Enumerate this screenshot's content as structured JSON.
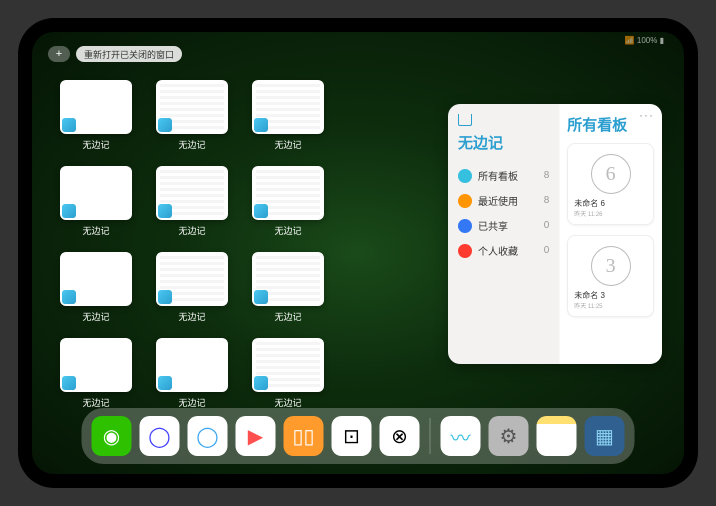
{
  "statusBar": {
    "battery": "100%"
  },
  "topBar": {
    "plusLabel": "+",
    "reopenLabel": "重新打开已关闭的窗口"
  },
  "appGrid": {
    "label": "无边记",
    "windows": [
      {
        "hasContent": false
      },
      {
        "hasContent": true
      },
      {
        "hasContent": true
      },
      null,
      {
        "hasContent": false
      },
      {
        "hasContent": true
      },
      {
        "hasContent": true
      },
      null,
      {
        "hasContent": false
      },
      {
        "hasContent": true
      },
      {
        "hasContent": true
      },
      null,
      {
        "hasContent": false
      },
      {
        "hasContent": false
      },
      {
        "hasContent": true
      },
      null
    ]
  },
  "panel": {
    "leftTitle": "无边记",
    "rightTitle": "所有看板",
    "moreLabel": "···",
    "menu": [
      {
        "label": "所有看板",
        "color": "#34C0DE",
        "count": "8"
      },
      {
        "label": "最近使用",
        "color": "#FF9500",
        "count": "8"
      },
      {
        "label": "已共享",
        "color": "#3478F6",
        "count": "0"
      },
      {
        "label": "个人收藏",
        "color": "#FF3B30",
        "count": "0"
      }
    ],
    "cards": [
      {
        "sketch": "6",
        "title": "未命名 6",
        "subtitle": "昨天 11:26"
      },
      {
        "sketch": "3",
        "title": "未命名 3",
        "subtitle": "昨天 11:25"
      }
    ]
  },
  "dock": {
    "items": [
      {
        "name": "wechat",
        "bg": "#2DC100",
        "glyph": "◉"
      },
      {
        "name": "browser1",
        "bg": "#FFFFFF",
        "glyph": "◯",
        "fg": "#4040FF"
      },
      {
        "name": "browser2",
        "bg": "#FFFFFF",
        "glyph": "◯",
        "fg": "#3BA6F0"
      },
      {
        "name": "video",
        "bg": "#FFFFFF",
        "glyph": "▶",
        "fg": "#FF5050"
      },
      {
        "name": "books",
        "bg": "#FF9A2D",
        "glyph": "▯▯"
      },
      {
        "name": "dice",
        "bg": "#FFFFFF",
        "glyph": "⊡",
        "fg": "#000"
      },
      {
        "name": "connect",
        "bg": "#FFFFFF",
        "glyph": "⊗",
        "fg": "#000"
      }
    ],
    "recent": [
      {
        "name": "freeform",
        "bg": "#FFFFFF",
        "glyph": "〰",
        "fg": "#34C0DE"
      },
      {
        "name": "settings",
        "bg": "#B8B8B8",
        "glyph": "⚙",
        "fg": "#555"
      },
      {
        "name": "notes",
        "bg": "linear-gradient(#FFE070 20%, #FFFFFF 20%)",
        "glyph": ""
      },
      {
        "name": "library",
        "bg": "#306090",
        "glyph": "▦",
        "fg": "#8AD0F0"
      }
    ]
  }
}
